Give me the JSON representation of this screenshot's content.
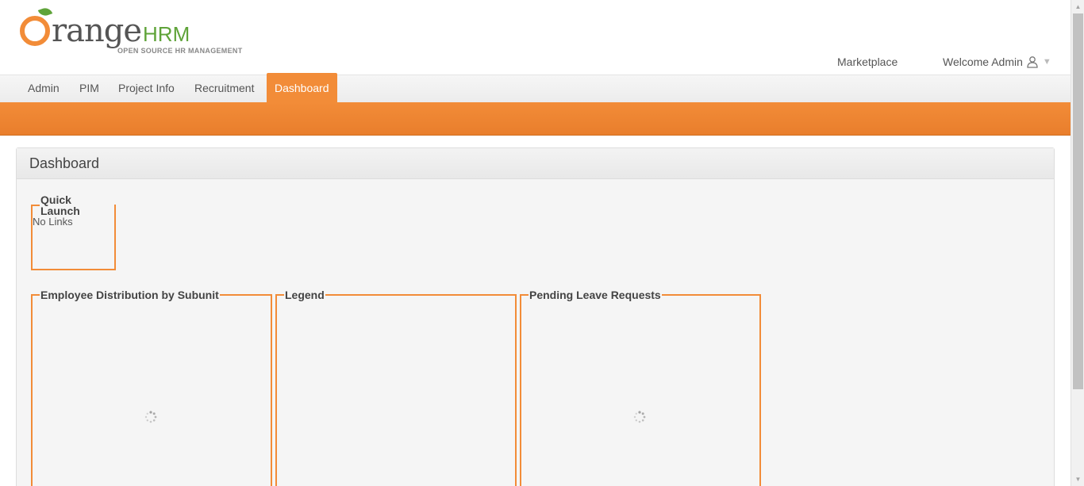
{
  "logo": {
    "word": "range",
    "hrm": "HRM",
    "tagline": "OPEN SOURCE HR MANAGEMENT"
  },
  "topnav": {
    "marketplace": "Marketplace",
    "welcome": "Welcome Admin"
  },
  "menu": {
    "items": [
      {
        "label": "Admin"
      },
      {
        "label": "PIM"
      },
      {
        "label": "Project Info"
      },
      {
        "label": "Recruitment"
      },
      {
        "label": "Dashboard",
        "active": true
      }
    ]
  },
  "colors": {
    "accent": "#f28c38",
    "logo_green": "#5fa339"
  },
  "dashboard": {
    "title": "Dashboard",
    "quick_launch": {
      "title": "Quick Launch",
      "empty_text": "No Links"
    },
    "panels": [
      {
        "title": "Employee Distribution by Subunit",
        "loading": true
      },
      {
        "title": "Legend",
        "loading": false
      },
      {
        "title": "Pending Leave Requests",
        "loading": true
      }
    ]
  },
  "icons": {
    "user": "user-icon",
    "dropdown": "caret-down-icon",
    "loading": "spinner-icon"
  }
}
